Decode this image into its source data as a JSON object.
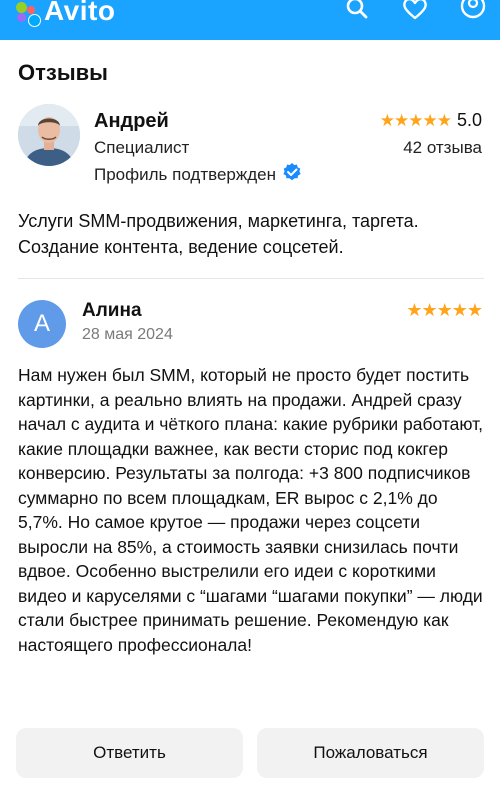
{
  "app": {
    "logo_text": "Avito"
  },
  "page": {
    "title": "Отзывы"
  },
  "seller": {
    "name": "Андрей",
    "role": "Специалист",
    "verified_label": "Профиль подтвержден",
    "rating_value": "5.0",
    "stars": "★★★★★",
    "reviews_count": "42 отзыва",
    "description": "Услуги SMM-продвижения, маркетинга, таргета. Создание контента, ведение соцсетей."
  },
  "review": {
    "author_initial": "А",
    "author_name": "Алина",
    "date": "28 мая 2024",
    "stars": "★★★★★",
    "text": "Нам нужен был SMM, который не просто будет постить картинки, а реально влиять на продажи. Андрей сразу начал с аудита и чёткого плана: какие рубрики работают, какие площадки важнее, как вести сторис под кокгер конверсию. Результаты за полгода: +3 800 подписчиков суммарно по всем площадкам, ER вырос с 2,1% до 5,7%. Но самое крутое — продажи через соцсети выросли на 85%, а стоимость заявки снизилась почти вдвое. Особенно выстрелили его идеи с короткими видео и каруселями с “шагами “шагами покупки” — люди стали быстрее принимать решение. Рекомендую как настоящего профессионала!"
  },
  "actions": {
    "reply_label": "Ответить",
    "report_label": "Пожаловаться"
  },
  "colors": {
    "brand_blue": "#1aa3ff",
    "star": "#ffa41b",
    "verified": "#1a8cff"
  },
  "icons": [
    "search-icon",
    "heart-icon",
    "profile-icon",
    "verified-icon"
  ]
}
